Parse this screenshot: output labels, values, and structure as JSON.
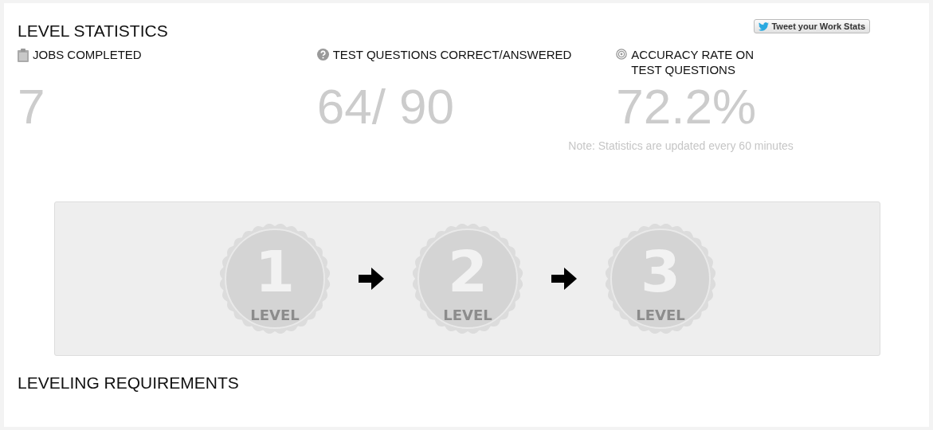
{
  "title": "LEVEL STATISTICS",
  "tweet_button": {
    "label": "Tweet your Work Stats"
  },
  "stats": [
    {
      "kind": "clipboard",
      "label": "JOBS COMPLETED",
      "value": "7"
    },
    {
      "kind": "question",
      "label": "TEST QUESTIONS CORRECT/ANSWERED",
      "value": "64/ 90"
    },
    {
      "kind": "target",
      "label": "ACCURACY RATE ON TEST QUESTIONS",
      "value": "72.2%"
    }
  ],
  "note": "Note: Statistics are updated every 60 minutes",
  "levels": [
    {
      "number": "1",
      "label": "LEVEL"
    },
    {
      "number": "2",
      "label": "LEVEL"
    },
    {
      "number": "3",
      "label": "LEVEL"
    }
  ],
  "section_heading": "LEVELING REQUIREMENTS"
}
